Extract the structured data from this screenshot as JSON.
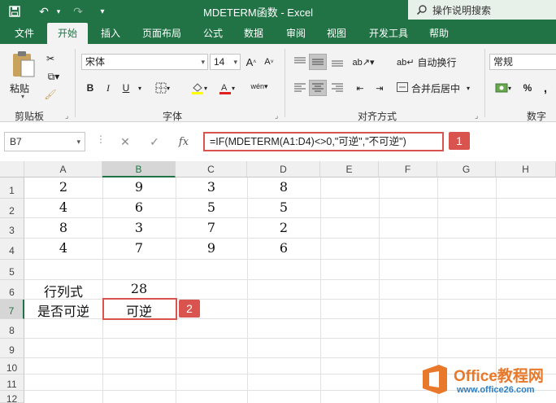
{
  "window": {
    "title": "MDETERM函数  -  Excel",
    "tell_me": "操作说明搜索"
  },
  "tabs": [
    {
      "label": "文件"
    },
    {
      "label": "开始"
    },
    {
      "label": "插入"
    },
    {
      "label": "页面布局"
    },
    {
      "label": "公式"
    },
    {
      "label": "数据"
    },
    {
      "label": "审阅"
    },
    {
      "label": "视图"
    },
    {
      "label": "开发工具"
    },
    {
      "label": "帮助"
    }
  ],
  "ribbon": {
    "clipboard": {
      "paste_label": "粘贴",
      "group_label": "剪贴板"
    },
    "font": {
      "font_name": "宋体",
      "font_size": "14",
      "bold": "B",
      "italic": "I",
      "underline": "U",
      "group_label": "字体"
    },
    "alignment": {
      "wrap_text": "自动换行",
      "merge_center": "合并后居中",
      "group_label": "对齐方式"
    },
    "number": {
      "format": "常规",
      "percent": "%",
      "comma": ",",
      "group_label": "数字"
    }
  },
  "formula_bar": {
    "name_box": "B7",
    "formula": "=IF(MDETERM(A1:D4)<>0,\"可逆\",\"不可逆\")",
    "callout": "1"
  },
  "sheet": {
    "columns": [
      "A",
      "B",
      "C",
      "D",
      "E",
      "F",
      "G",
      "H"
    ],
    "rows": [
      "1",
      "2",
      "3",
      "4",
      "5",
      "6",
      "7",
      "8",
      "9",
      "10",
      "11",
      "12"
    ],
    "cells": {
      "A1": "2",
      "B1": "9",
      "C1": "3",
      "D1": "8",
      "A2": "4",
      "B2": "6",
      "C2": "5",
      "D2": "5",
      "A3": "8",
      "B3": "3",
      "C3": "7",
      "D3": "2",
      "A4": "4",
      "B4": "7",
      "C4": "9",
      "D4": "6",
      "A6": "行列式",
      "B6": "28",
      "A7": "是否可逆",
      "B7": "可逆"
    },
    "active_cell_callout": "2"
  },
  "watermark": {
    "brand": "Office教程网",
    "url": "www.office26.com"
  },
  "colors": {
    "excel_green": "#217346",
    "callout_red": "#d9534f",
    "watermark_orange": "#e8782a"
  }
}
